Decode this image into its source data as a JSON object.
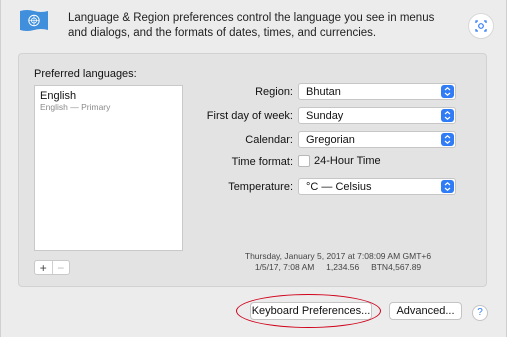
{
  "header": {
    "description": "Language & Region preferences control the language you see in menus and dialogs, and the formats of dates, times, and currencies."
  },
  "languages": {
    "label": "Preferred languages:",
    "items": [
      {
        "name": "English",
        "detail": "English — Primary"
      }
    ],
    "add_label": "+",
    "remove_label": "−"
  },
  "settings": {
    "region": {
      "label": "Region:",
      "value": "Bhutan"
    },
    "first_day": {
      "label": "First day of week:",
      "value": "Sunday"
    },
    "calendar": {
      "label": "Calendar:",
      "value": "Gregorian"
    },
    "time_format": {
      "label": "Time format:",
      "checkbox_label": "24-Hour Time",
      "checked": false
    },
    "temperature": {
      "label": "Temperature:",
      "value": "°C — Celsius"
    }
  },
  "sample": {
    "line1": "Thursday, January 5, 2017 at 7:08:09 AM GMT+6",
    "line2": "1/5/17, 7:08 AM     1,234.56     BTN4,567.89"
  },
  "buttons": {
    "keyboard": "Keyboard Preferences...",
    "advanced": "Advanced...",
    "help": "?"
  },
  "colors": {
    "accent": "#2f7cf6",
    "highlight": "#d0021b"
  }
}
